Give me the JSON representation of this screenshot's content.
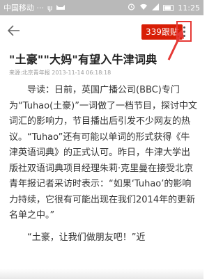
{
  "status_bar": {
    "carrier": "中国移动 ···",
    "time": "11:25",
    "icons": [
      "usb-icon",
      "cat-icon",
      "alarm-icon",
      "wifi-icon",
      "signal-icon",
      "battery-icon"
    ]
  },
  "app_bar": {
    "back_icon": "back-arrow-icon",
    "comments_label": "339跟贴",
    "more_icon": "more-vertical-icon"
  },
  "article": {
    "title": "\"土豪\"\"大妈\"有望入牛津词典",
    "meta": "来源:北京青年报 2013-11-14 06:18:18",
    "paragraph1": "导读：日前，英国广播公司(BBC)专门为“Tuhao(土豪)”一词做了一档节目，探讨中文词汇的影响力，节目播出后引发不少网友的热议。“Tuhao”还有可能以单词的形式获得《牛津英语词典》的正式认可。昨日，牛津大学出版社双语词典项目经理朱莉·克里曼在接受北京青年报记者采访时表示：“如果‘Tuhao’的影响力持续，它很有可能出现在我们2014年的更新名单之中。”",
    "paragraph2": "“土豪，让我们做朋友吧！”近"
  },
  "colors": {
    "status_bar_bg": "#b9b9b9",
    "badge_red": "#d81e06",
    "annotation_red": "#e53935"
  }
}
